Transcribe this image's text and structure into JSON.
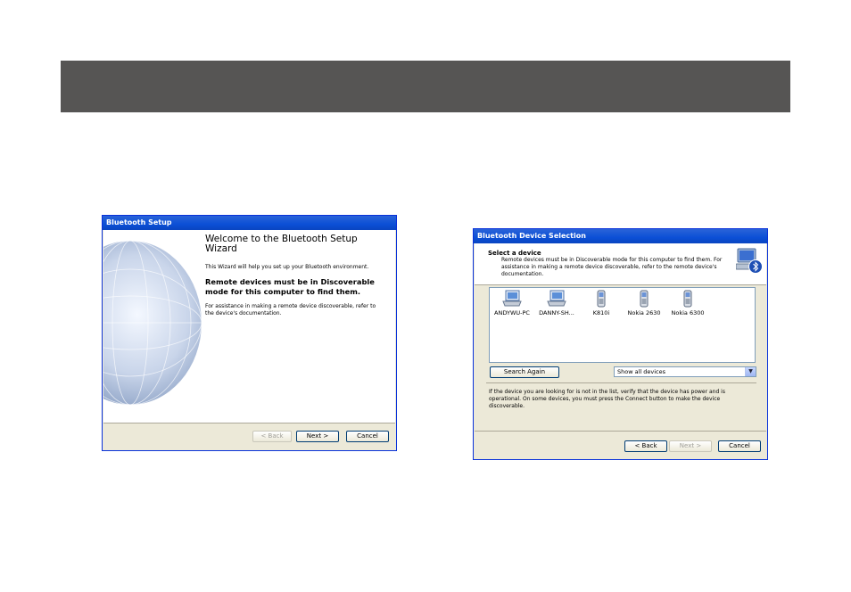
{
  "setup_window": {
    "title": "Bluetooth Setup",
    "heading": "Welcome to the Bluetooth Setup Wizard",
    "intro": "This Wizard will help you set up your Bluetooth environment.",
    "bold_text": "Remote devices must be in Discoverable mode for this computer to find them.",
    "assist_text": "For assistance in making a remote device discoverable, refer to the device's documentation.",
    "buttons": {
      "back": "< Back",
      "next": "Next >",
      "cancel": "Cancel"
    }
  },
  "selection_window": {
    "title": "Bluetooth Device Selection",
    "header_title": "Select a device",
    "header_sub": "Remote devices must be in Discoverable mode for this computer to find them. For assistance in making a remote device discoverable, refer to the remote device's documentation.",
    "devices": [
      {
        "name": "ANDYWU-PC",
        "icon": "laptop-icon"
      },
      {
        "name": "DANNY-SH...",
        "icon": "laptop-icon"
      },
      {
        "name": "K810i",
        "icon": "phone-icon"
      },
      {
        "name": "Nokia 2630",
        "icon": "phone-icon"
      },
      {
        "name": "Nokia 6300",
        "icon": "phone-icon"
      }
    ],
    "search_again": "Search Again",
    "filter_value": "Show all devices",
    "note": "If the device you are looking for is not in the list, verify that the device has power and is operational. On some devices, you must press the Connect button to make the device discoverable.",
    "buttons": {
      "back": "< Back",
      "next": "Next >",
      "cancel": "Cancel"
    }
  }
}
